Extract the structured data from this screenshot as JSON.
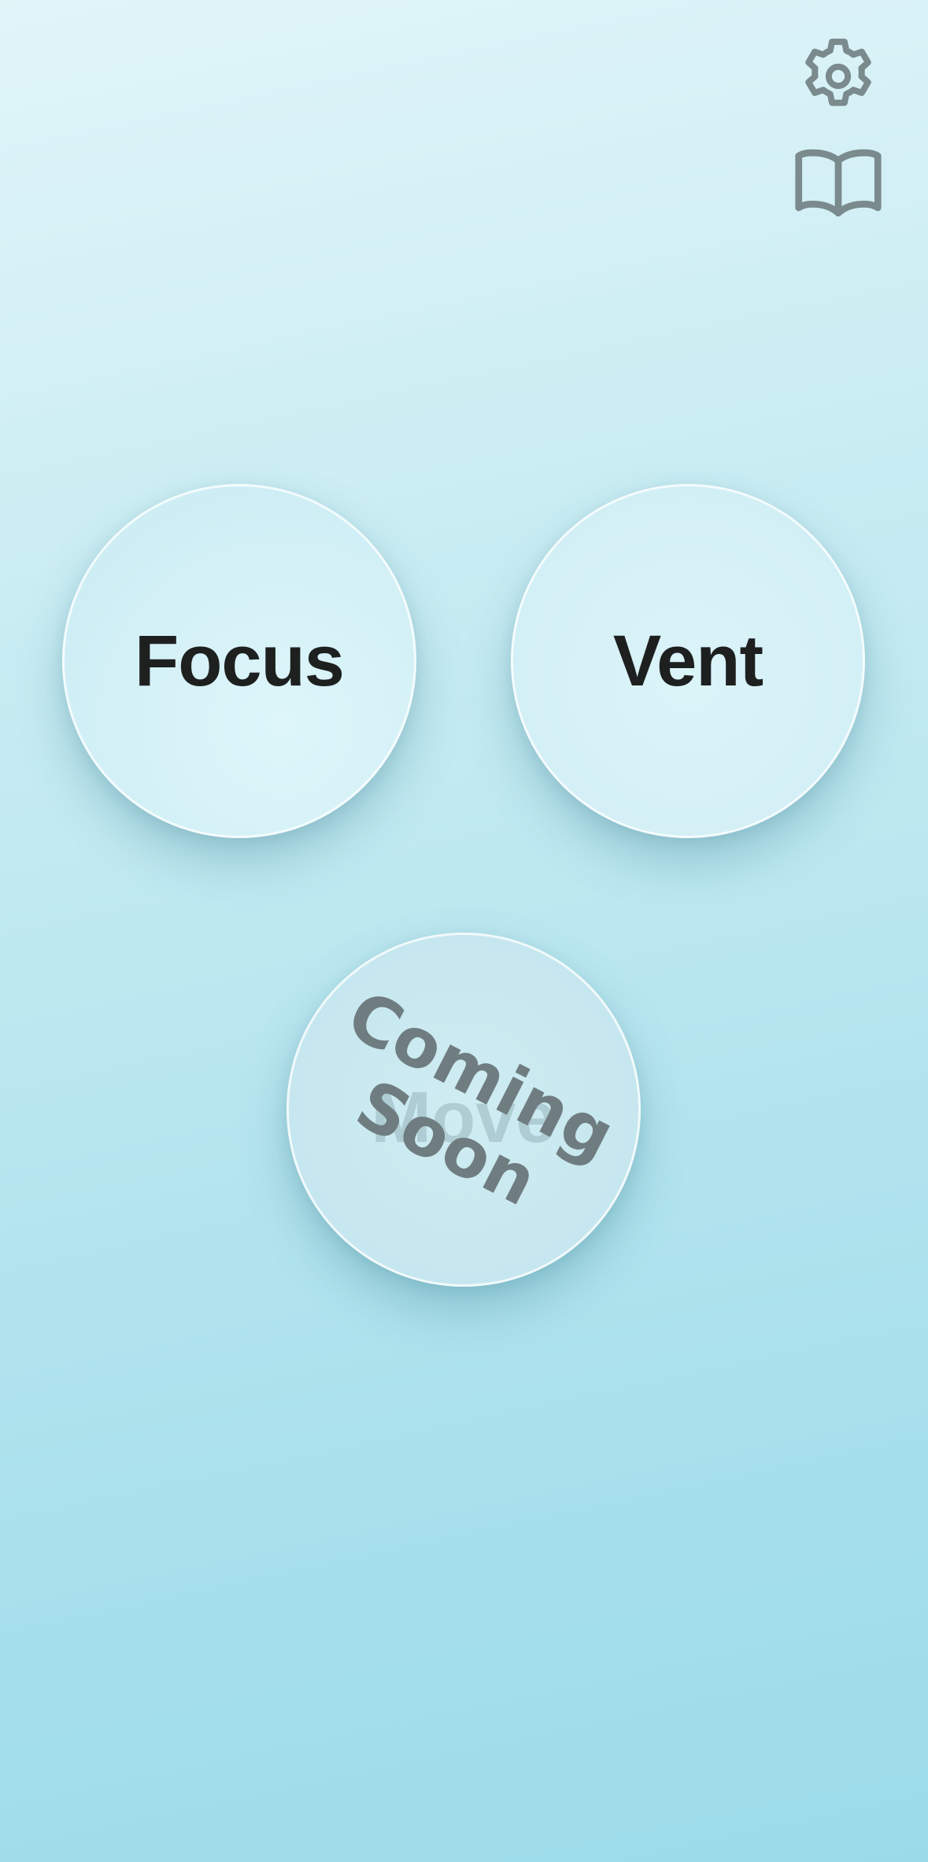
{
  "header": {
    "settings_icon": "gear-icon",
    "guide_icon": "open-book-icon",
    "icon_color": "#7a8a8d"
  },
  "buttons": {
    "focus_label": "Focus",
    "vent_label": "Vent",
    "move_label": "Move",
    "coming_soon_line1": "Coming",
    "coming_soon_line2": "Soon"
  },
  "colors": {
    "label_text": "#1e2020",
    "coming_soon_text": "#6f7d80"
  }
}
